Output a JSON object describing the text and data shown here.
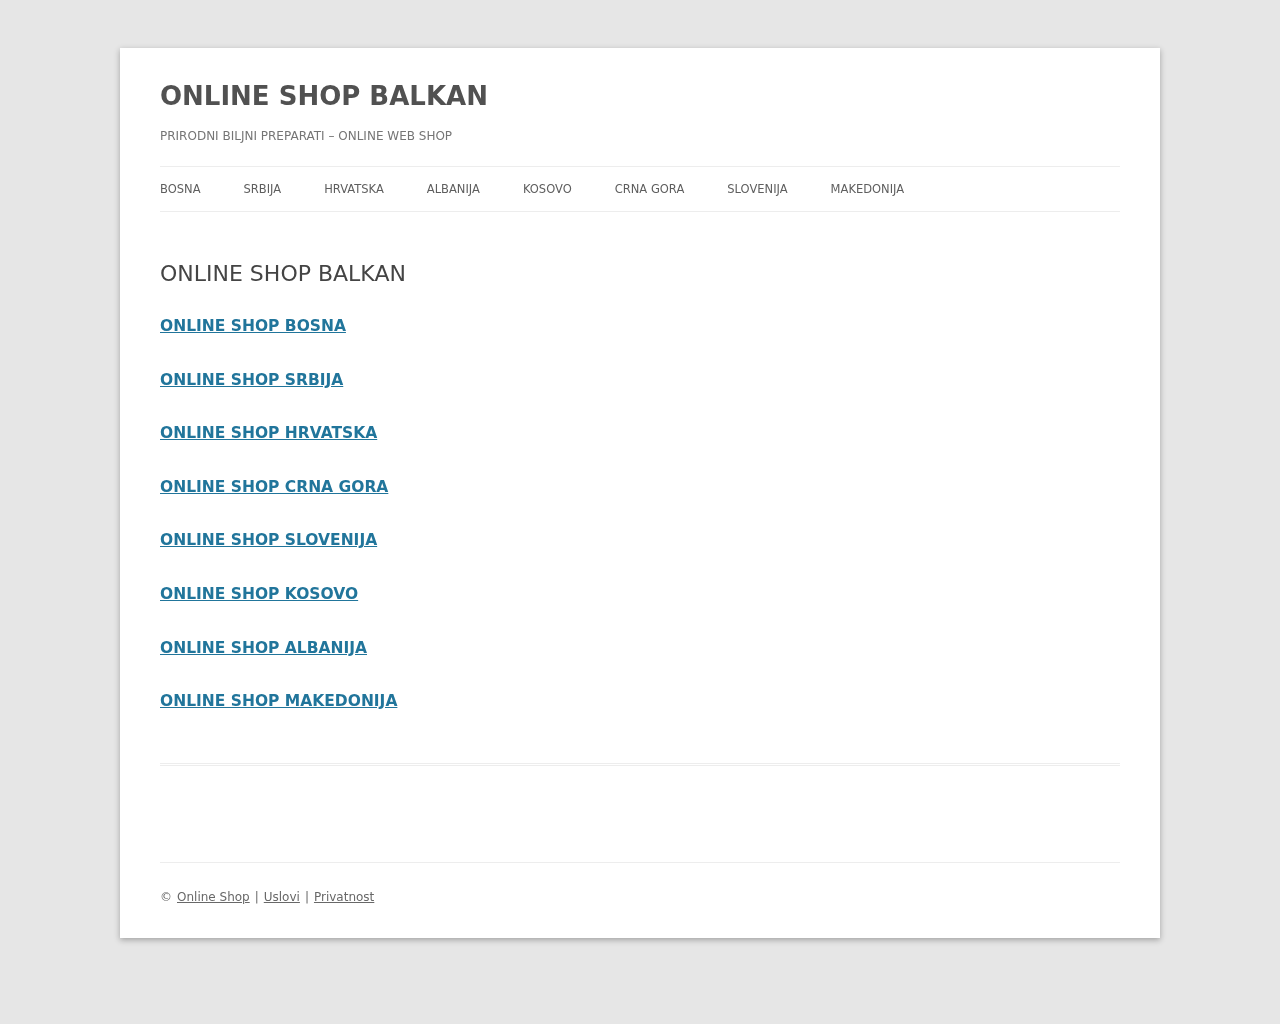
{
  "site": {
    "title": "ONLINE SHOP BALKAN",
    "tagline": "PRIRODNI BILJNI PREPARATI – ONLINE WEB SHOP"
  },
  "nav": [
    "BOSNA",
    "SRBIJA",
    "HRVATSKA",
    "ALBANIJA",
    "KOSOVO",
    "CRNA GORA",
    "SLOVENIJA",
    "MAKEDONIJA"
  ],
  "page": {
    "heading": "ONLINE SHOP BALKAN",
    "links": [
      "ONLINE SHOP BOSNA",
      "ONLINE SHOP SRBIJA",
      "ONLINE SHOP HRVATSKA",
      "ONLINE SHOP CRNA GORA",
      "ONLINE SHOP SLOVENIJA",
      "ONLINE SHOP KOSOVO",
      "ONLINE SHOP ALBANIJA",
      "ONLINE SHOP MAKEDONIJA"
    ]
  },
  "footer": {
    "copyright": "©",
    "links": [
      "Online Shop",
      "Uslovi",
      "Privatnost"
    ],
    "separator": "|"
  }
}
